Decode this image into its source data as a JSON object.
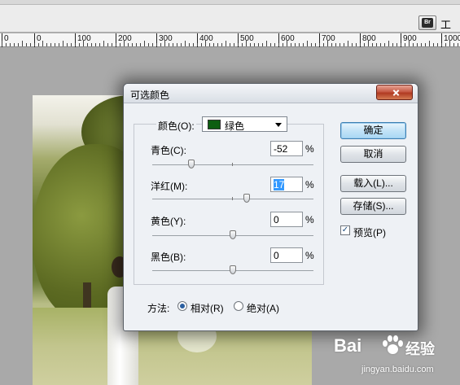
{
  "toolbar": {
    "bridge_icon_text": "Br",
    "workspace_label": "工"
  },
  "ruler": {
    "ticks": [
      "0",
      "100",
      "200",
      "300",
      "400",
      "500",
      "600",
      "700",
      "800",
      "900",
      "1000"
    ],
    "left_start": "0"
  },
  "dialog": {
    "title": "可选颜色",
    "colors_label": "颜色(O):",
    "colors_value": "绿色",
    "swatch_color": "#0d5e11",
    "sliders": [
      {
        "label": "青色(C):",
        "value": "-52",
        "unit": "%",
        "level": -52
      },
      {
        "label": "洋红(M):",
        "value": "17",
        "unit": "%",
        "level": 17
      },
      {
        "label": "黄色(Y):",
        "value": "0",
        "unit": "%",
        "level": 0
      },
      {
        "label": "黑色(B):",
        "value": "0",
        "unit": "%",
        "level": 0
      }
    ],
    "method_label": "方法:",
    "method_relative": "相对(R)",
    "method_absolute": "绝对(A)",
    "buttons": {
      "ok": "确定",
      "cancel": "取消",
      "load": "载入(L)...",
      "save": "存储(S)..."
    },
    "preview_label": "预览(P)"
  },
  "watermark": {
    "brand_left": "Bai",
    "brand_right": "经验",
    "url": "jingyan.baidu.com"
  }
}
